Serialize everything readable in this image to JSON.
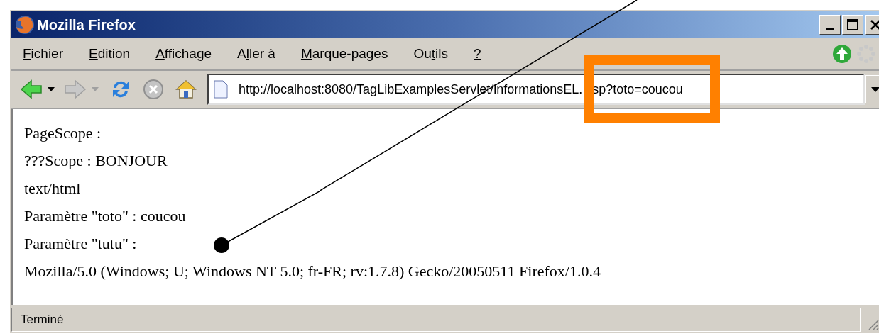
{
  "window": {
    "title": "Mozilla Firefox"
  },
  "menu": [
    {
      "segments": [
        {
          "text": "F",
          "underlined": true
        },
        {
          "text": "ichier",
          "underlined": false
        }
      ]
    },
    {
      "segments": [
        {
          "text": "E",
          "underlined": true
        },
        {
          "text": "dition",
          "underlined": false
        }
      ]
    },
    {
      "segments": [
        {
          "text": "A",
          "underlined": true
        },
        {
          "text": "ffichage",
          "underlined": false
        }
      ]
    },
    {
      "segments": [
        {
          "text": "A",
          "underlined": false
        },
        {
          "text": "l",
          "underlined": true
        },
        {
          "text": "ler à",
          "underlined": false
        }
      ]
    },
    {
      "segments": [
        {
          "text": "M",
          "underlined": true
        },
        {
          "text": "arque-pages",
          "underlined": false
        }
      ]
    },
    {
      "segments": [
        {
          "text": "Ou",
          "underlined": false
        },
        {
          "text": "t",
          "underlined": true
        },
        {
          "text": "ils",
          "underlined": false
        }
      ]
    },
    {
      "segments": [
        {
          "text": "?",
          "underlined": true
        }
      ]
    }
  ],
  "toolbar": {
    "back_disabled": false,
    "forward_disabled": true,
    "stop_disabled": true
  },
  "address": {
    "visible_before_highlight": "http://localhost:8080/TagLibExamplesServlet/informationsEL.",
    "visible_in_highlight": "sp?toto=coucou"
  },
  "content": [
    "PageScope :",
    "???Scope : BONJOUR",
    "text/html",
    "Paramètre \"toto\" : coucou",
    "Paramètre \"tutu\" :",
    "Mozilla/5.0 (Windows; U; Windows NT 5.0; fr-FR; rv:1.7.8) Gecko/20050511 Firefox/1.0.4"
  ],
  "status_bar": {
    "text": "Terminé"
  }
}
